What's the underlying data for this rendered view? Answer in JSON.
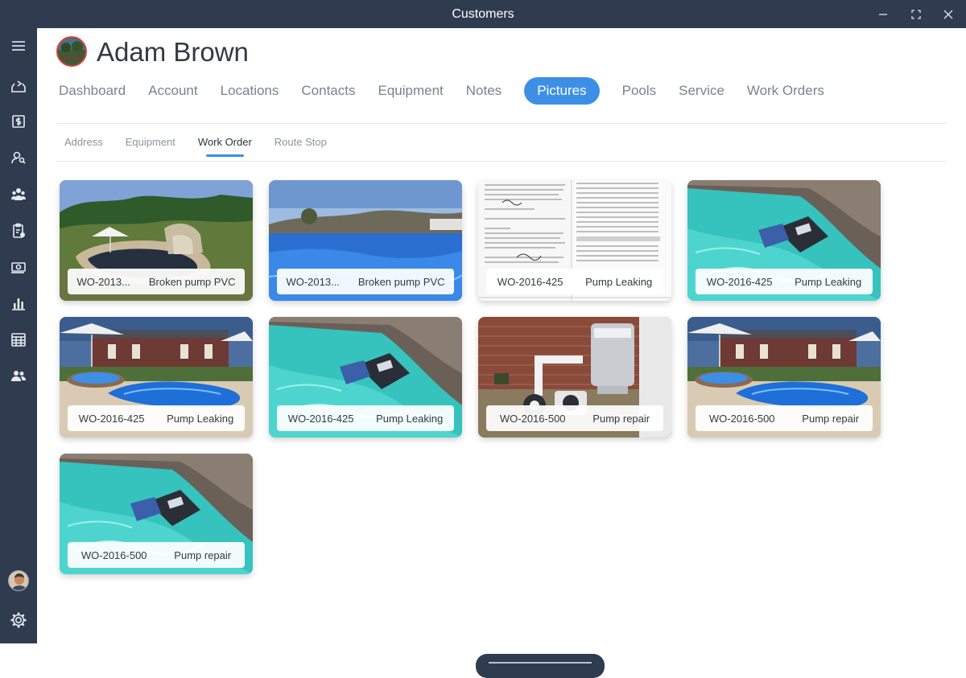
{
  "window": {
    "title": "Customers"
  },
  "customer": {
    "name": "Adam Brown"
  },
  "tabs": [
    {
      "label": "Dashboard"
    },
    {
      "label": "Account"
    },
    {
      "label": "Locations"
    },
    {
      "label": "Contacts"
    },
    {
      "label": "Equipment"
    },
    {
      "label": "Notes"
    },
    {
      "label": "Pictures",
      "active": true
    },
    {
      "label": "Pools"
    },
    {
      "label": "Service"
    },
    {
      "label": "Work Orders"
    }
  ],
  "subtabs": [
    {
      "label": "Address"
    },
    {
      "label": "Equipment"
    },
    {
      "label": "Work Order",
      "active": true
    },
    {
      "label": "Route Stop"
    }
  ],
  "pictures": [
    {
      "work_order": "WO-2013...",
      "description": "Broken pump PVC",
      "scene": "backyard-pool"
    },
    {
      "work_order": "WO-2013...",
      "description": "Broken pump PVC",
      "scene": "infinity-pool"
    },
    {
      "work_order": "WO-2016-425",
      "description": "Pump Leaking",
      "scene": "document"
    },
    {
      "work_order": "WO-2016-425",
      "description": "Pump Leaking",
      "scene": "pool-cleaner"
    },
    {
      "work_order": "WO-2016-425",
      "description": "Pump Leaking",
      "scene": "house-pool"
    },
    {
      "work_order": "WO-2016-425",
      "description": "Pump Leaking",
      "scene": "pool-cleaner"
    },
    {
      "work_order": "WO-2016-500",
      "description": "Pump repair",
      "scene": "pump-equipment"
    },
    {
      "work_order": "WO-2016-500",
      "description": "Pump repair",
      "scene": "house-pool"
    },
    {
      "work_order": "WO-2016-500",
      "description": "Pump repair",
      "scene": "pool-cleaner"
    }
  ],
  "sidebar": {
    "icons": [
      "menu-icon",
      "inbox-icon",
      "billing-icon",
      "customer-search-icon",
      "team-icon",
      "clipboard-icon",
      "payment-icon",
      "reports-icon",
      "calendar-icon",
      "users-icon"
    ],
    "bottom": [
      "user-avatar",
      "settings-icon"
    ]
  },
  "colors": {
    "accent": "#3d8fe6",
    "chrome": "#2f3b4e"
  }
}
